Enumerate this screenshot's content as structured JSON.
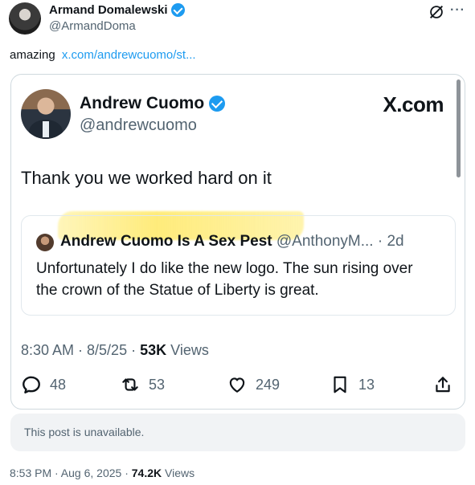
{
  "outer": {
    "name": "Armand Domalewski",
    "handle": "@ArmandDoma",
    "text": "amazing",
    "link": "x.com/andrewcuomo/st..."
  },
  "embed": {
    "name": "Andrew Cuomo",
    "handle": "@andrewcuomo",
    "brand": "X.com",
    "text": "Thank you we worked hard on it",
    "quote": {
      "name": "Andrew Cuomo Is A Sex Pest",
      "handle": "@AnthonyM...",
      "age": "· 2d",
      "text": "Unfortunately I do like the new logo. The sun rising over the crown of the Statue of Liberty is great."
    },
    "meta": {
      "time": "8:30 AM · 8/5/25 ·",
      "views_count": "53K",
      "views_label": "Views"
    },
    "actions": {
      "replies": "48",
      "reposts": "53",
      "likes": "249",
      "bookmarks": "13"
    }
  },
  "unavailable_text": "This post is unavailable.",
  "footer": {
    "time": "8:53 PM · Aug 6, 2025 ·",
    "views_count": "74.2K",
    "views_label": "Views"
  },
  "colors": {
    "accent": "#1d9bf0",
    "secondary_text": "#536471",
    "highlight": "#ffe864"
  }
}
